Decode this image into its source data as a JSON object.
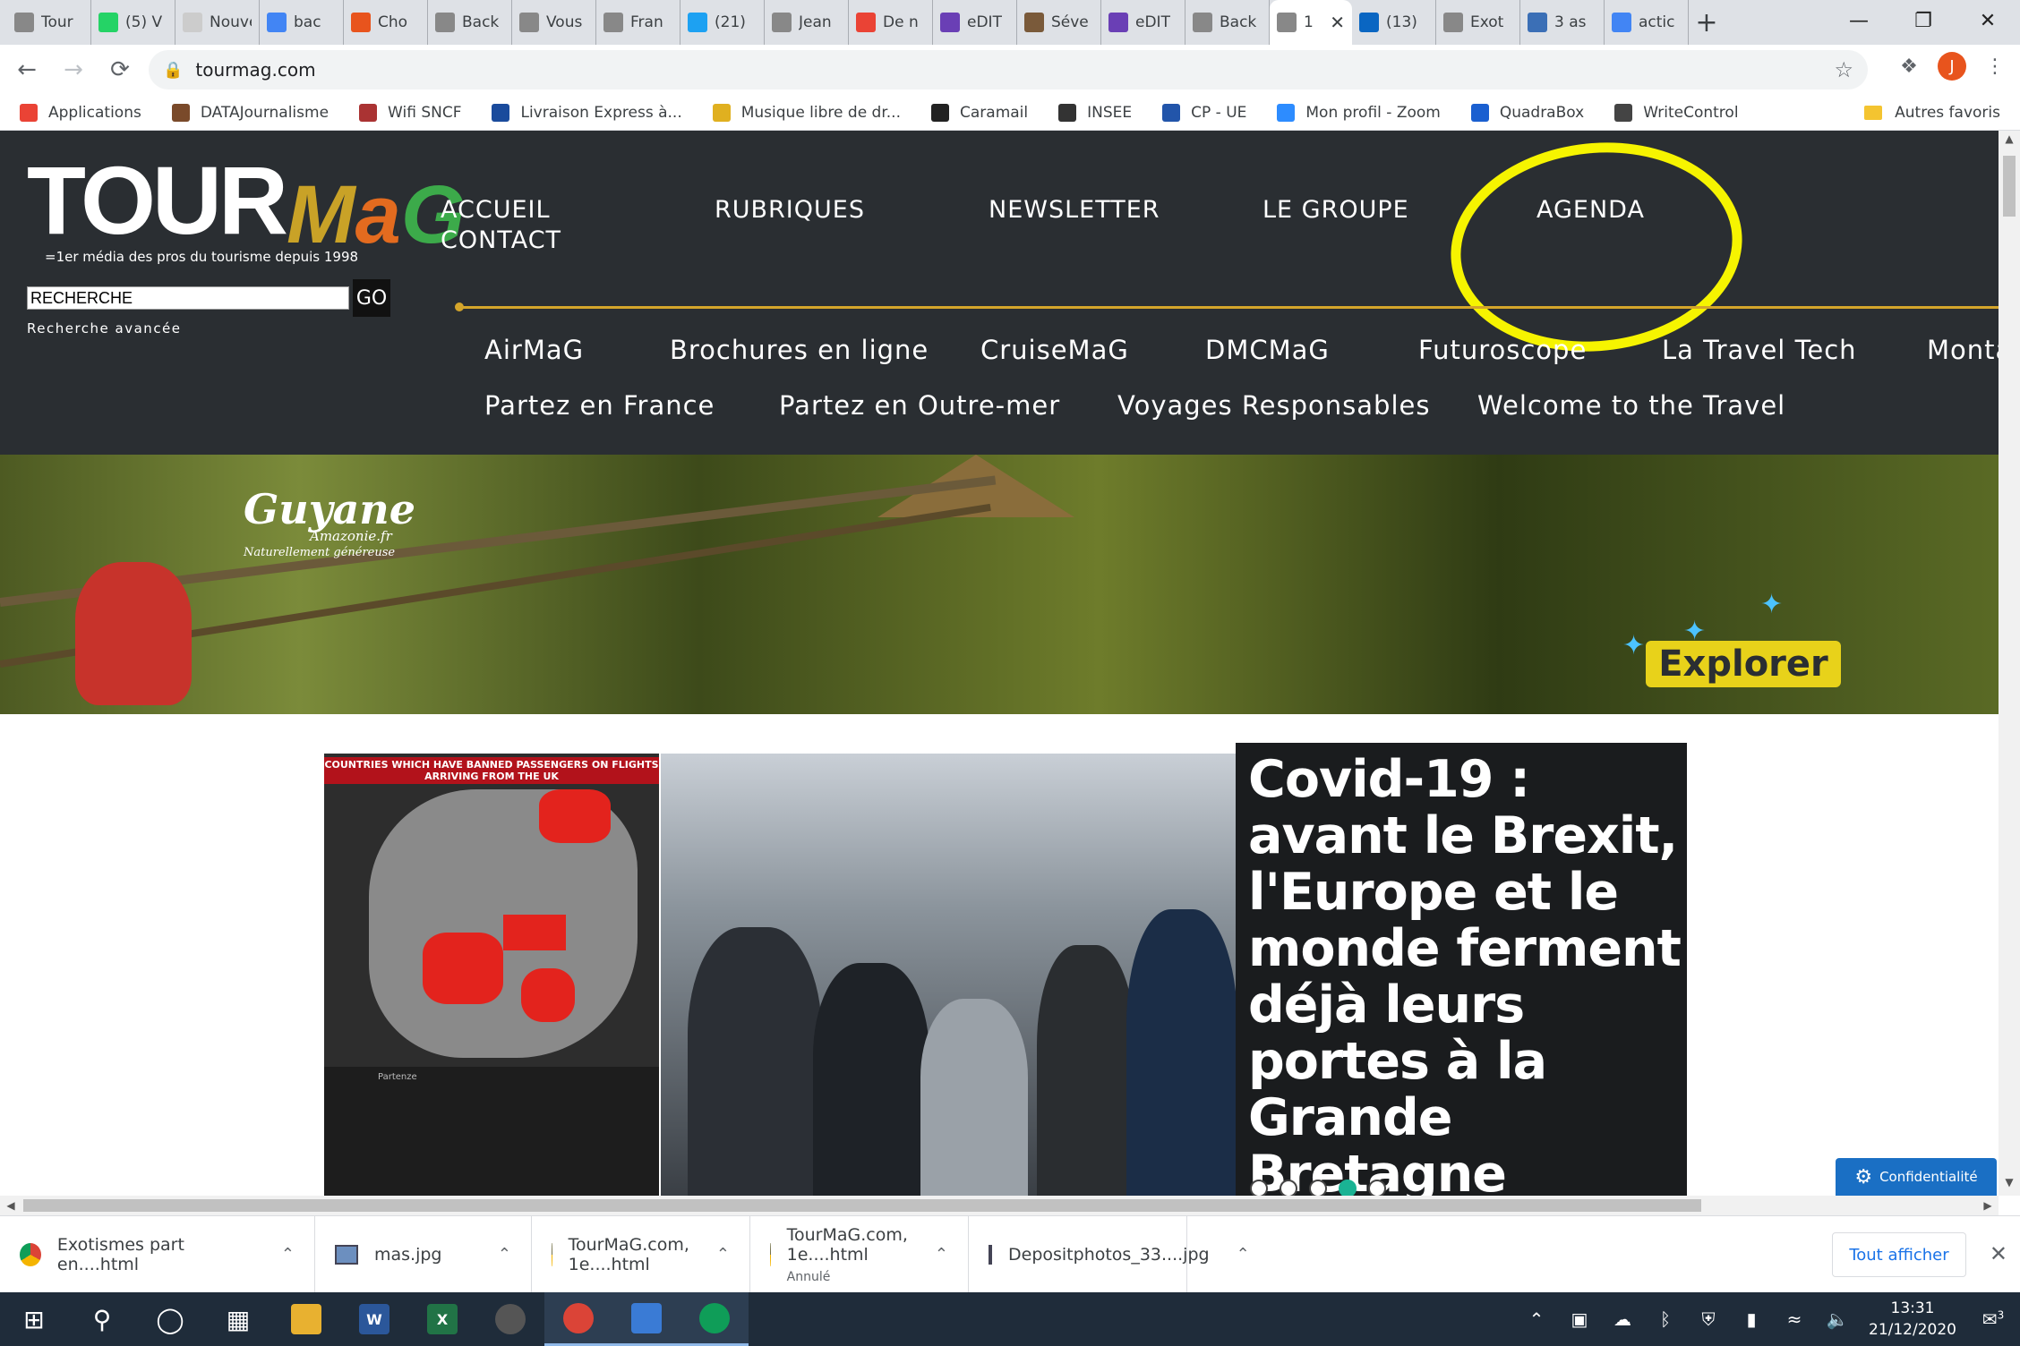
{
  "browser": {
    "tabs": [
      {
        "label": "Tour",
        "icon": "tm-icon",
        "color": "#888888"
      },
      {
        "label": "(5) V",
        "icon": "whatsapp-icon",
        "color": "#25d366"
      },
      {
        "label": "Nouvel o",
        "icon": "page-icon",
        "color": "#cccccc"
      },
      {
        "label": "bac",
        "icon": "docs-icon",
        "color": "#4285f4"
      },
      {
        "label": "Cho",
        "icon": "cloud-icon",
        "color": "#e8541d"
      },
      {
        "label": "Back",
        "icon": "tm-icon",
        "color": "#888888"
      },
      {
        "label": "Vous",
        "icon": "tm-icon",
        "color": "#888888"
      },
      {
        "label": "Fran",
        "icon": "tm-icon",
        "color": "#888888"
      },
      {
        "label": "(21)",
        "icon": "twitter-icon",
        "color": "#1da1f2"
      },
      {
        "label": "Jean",
        "icon": "tm-icon",
        "color": "#888888"
      },
      {
        "label": "De n",
        "icon": "gmail-icon",
        "color": "#ea4335"
      },
      {
        "label": "eDIT",
        "icon": "edit-icon",
        "color": "#6a3fb5"
      },
      {
        "label": "Séve",
        "icon": "page-icon",
        "color": "#7a5a3a"
      },
      {
        "label": "eDIT",
        "icon": "edit-icon",
        "color": "#6a3fb5"
      },
      {
        "label": "Back",
        "icon": "tm-icon",
        "color": "#888888"
      },
      {
        "label": "1",
        "icon": "tm-icon",
        "color": "#888888",
        "active": true
      },
      {
        "label": "(13)",
        "icon": "linkedin-icon",
        "color": "#0a66c2"
      },
      {
        "label": "Exot",
        "icon": "tm-icon",
        "color": "#888888"
      },
      {
        "label": "3 as",
        "icon": "app-icon",
        "color": "#3b6fb6"
      },
      {
        "label": "actic",
        "icon": "google-icon",
        "color": "#4285f4"
      }
    ],
    "tab_close": "✕",
    "new_tab": "+",
    "url": "tourmag.com",
    "profile_initial": "J",
    "bookmarks": [
      {
        "label": "Applications",
        "color": "#ea4335"
      },
      {
        "label": "DATAJournalisme",
        "color": "#7a4a2a"
      },
      {
        "label": "Wifi SNCF",
        "color": "#a33"
      },
      {
        "label": "Livraison Express à...",
        "color": "#1a4b9c"
      },
      {
        "label": "Musique libre de dr...",
        "color": "#e0b020"
      },
      {
        "label": "Caramail",
        "color": "#222222"
      },
      {
        "label": "INSEE",
        "color": "#333333"
      },
      {
        "label": "CP - UE",
        "color": "#2255aa"
      },
      {
        "label": "Mon profil - Zoom",
        "color": "#2d8cff"
      },
      {
        "label": "QuadraBox",
        "color": "#1a5fd0"
      },
      {
        "label": "WriteControl",
        "color": "#444444"
      }
    ],
    "bookmarks_other": "Autres favoris"
  },
  "site": {
    "logo_word": "TOUR",
    "logo_mag": "MaG",
    "logo_tagline": "=1er média des pros du tourisme depuis 1998",
    "search_value": "RECHERCHE",
    "search_go": "GO",
    "advanced_search": "Recherche avancée",
    "main_nav": {
      "accueil": "ACCUEIL",
      "contact": "CONTACT",
      "rubriques": "RUBRIQUES",
      "newsletter": "NEWSLETTER",
      "groupe": "LE GROUPE",
      "agenda": "AGENDA"
    },
    "sub_nav_row1": [
      "AirMaG",
      "Brochures en ligne",
      "CruiseMaG",
      "DMCMaG",
      "Futuroscope",
      "La Travel Tech",
      "Monta"
    ],
    "sub_nav_row2": [
      "Partez en France",
      "Partez en Outre-mer",
      "Voyages Responsables",
      "Welcome to the Travel"
    ],
    "banner": {
      "brand": "Guyane",
      "brand_domain": "Amazonie.fr",
      "brand_slogan": "Naturellement généreuse",
      "cta": "Explorer"
    },
    "hero": {
      "map_title": "COUNTRIES WHICH HAVE BANNED PASSENGERS ON FLIGHTS ARRIVING FROM THE UK",
      "board_title": "Partenze",
      "title": "Covid-19 : avant le Brexit, l'Europe et le monde ferment déjà leurs portes à la Grande Bretagne",
      "slide_count": 5,
      "active_slide": 4
    },
    "cookie_button": "Confidentialité"
  },
  "downloads": [
    {
      "name": "Exotismes part en....html",
      "type": "chrome"
    },
    {
      "name": "mas.jpg",
      "type": "image"
    },
    {
      "name": "TourMaG.com, 1e....html",
      "type": "chrome"
    },
    {
      "name": "TourMaG.com, 1e....html",
      "type": "chrome",
      "status": "Annulé"
    },
    {
      "name": "Depositphotos_33....jpg",
      "type": "image"
    }
  ],
  "downloads_show_all": "Tout afficher",
  "taskbar": {
    "time": "13:31",
    "date": "21/12/2020",
    "notifications": "3"
  },
  "colors": {
    "header_bg": "#2a2e32",
    "accent_gold": "#d4a52b",
    "highlight_yellow": "#f6f400",
    "cookie_blue": "#1a6fc4"
  }
}
